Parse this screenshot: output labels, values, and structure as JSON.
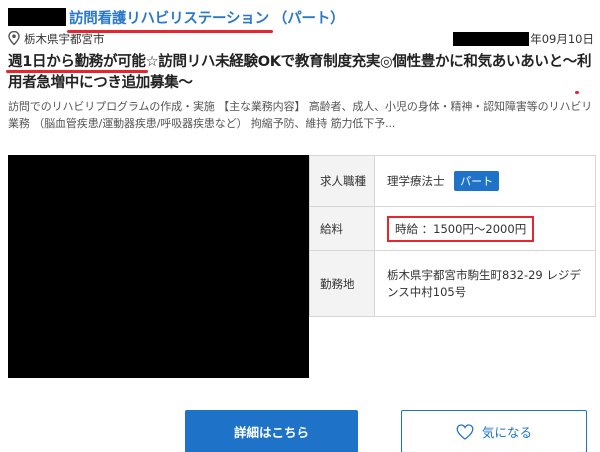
{
  "job": {
    "facility_name": "訪問看護リハビリステーション",
    "employment_type_label": "（パート）",
    "location": "栃木県宇都宮市",
    "date_suffix": "年09月10日",
    "headline": {
      "part1": "週1日から勤務が可能",
      "part2": "☆訪問リハ未経験OKで教育制度充実◎個性豊かに和気あいあいと〜",
      "part3": "利用者急増中",
      "part4": "につき追加募集〜"
    },
    "description": "訪問でのリハビリプログラムの作成・実施 【主な業務内容】 高齢者、成人、小児の身体・精神・認知障害等のリハビリ業務 （脳血管疾患/運動器疾患/呼吸器疾患など） 拘縮予防、維持 筋力低下予..."
  },
  "info_table": {
    "role_label": "求人職種",
    "role_value": "理学療法士",
    "role_badge": "パート",
    "salary_label": "給料",
    "salary_value": "時給 ：1500円〜2000円",
    "place_label": "勤務地",
    "place_value": "栃木県宇都宮市駒生町832-29 レジデンス中村105号"
  },
  "buttons": {
    "detail_label": "詳細はこちら",
    "favorite_label": "気になる"
  },
  "colors": {
    "accent_blue": "#1e73c8",
    "link_blue": "#2a78c8",
    "highlight_red": "#e6262e"
  },
  "icons": {
    "location": "map-pin-icon",
    "favorite": "heart-outline-icon"
  }
}
